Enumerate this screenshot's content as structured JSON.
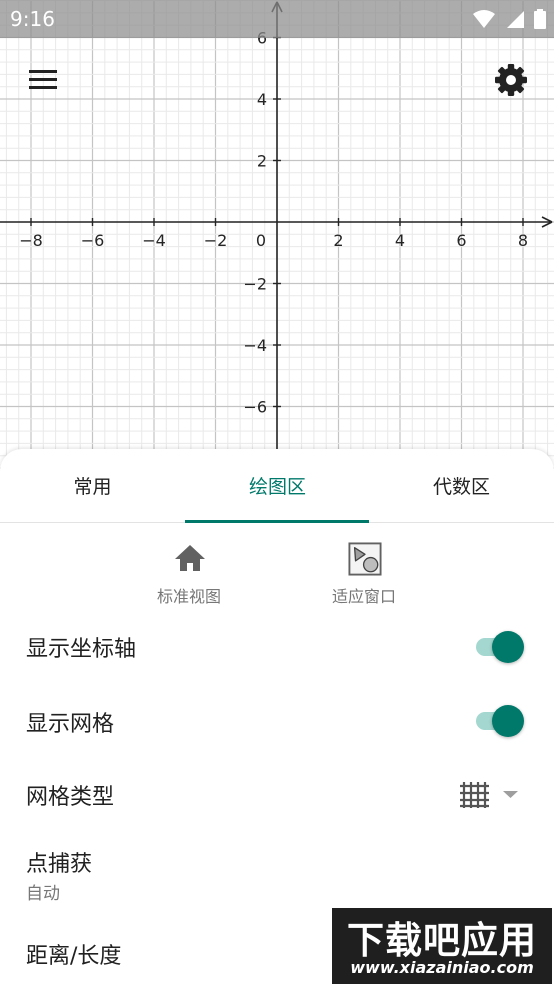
{
  "status_bar": {
    "time": "9:16"
  },
  "graph": {
    "x_ticks": [
      "−8",
      "−6",
      "−4",
      "−2",
      "0",
      "2",
      "4",
      "6",
      "8"
    ],
    "y_ticks": [
      "6",
      "4",
      "2",
      "−2",
      "−4",
      "−6"
    ],
    "x_values": [
      -8,
      -6,
      -4,
      -2,
      2,
      4,
      6,
      8
    ],
    "y_values": [
      6,
      4,
      2,
      -2,
      -4,
      -6
    ],
    "grid": true,
    "axes": true
  },
  "toolbar": {
    "menu_icon": "hamburger-menu-icon",
    "settings_icon": "gear-icon"
  },
  "tabs": [
    {
      "label": "常用",
      "active": false
    },
    {
      "label": "绘图区",
      "active": true
    },
    {
      "label": "代数区",
      "active": false
    }
  ],
  "view_buttons": [
    {
      "label": "标准视图",
      "icon": "home-icon"
    },
    {
      "label": "适应窗口",
      "icon": "zoom-to-fit-icon"
    }
  ],
  "settings": {
    "show_axes": {
      "label": "显示坐标轴",
      "on": true
    },
    "show_grid": {
      "label": "显示网格",
      "on": true
    },
    "grid_type": {
      "label": "网格类型",
      "icon": "grid-icon"
    },
    "point_capture": {
      "label": "点捕获",
      "value": "自动"
    },
    "distance": {
      "label": "距离/长度"
    }
  },
  "watermark": {
    "text": "下载吧应用",
    "url": "www.xiazainiao.com"
  },
  "colors": {
    "accent": "#00796b",
    "toggle_track": "#a3d7cf",
    "status_bar": "#8c8c8c"
  }
}
